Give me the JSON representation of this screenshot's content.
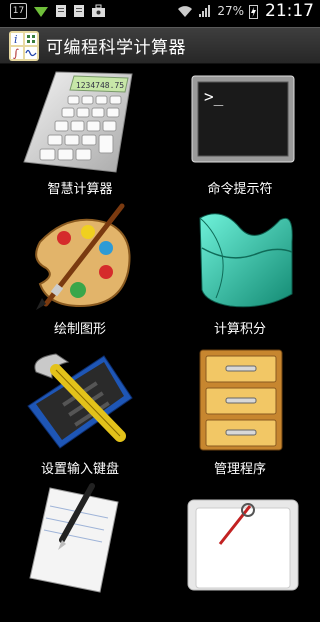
{
  "status_bar": {
    "notification_count": "17",
    "battery_percent": "27%",
    "time": "21:17",
    "icons": [
      "badge-icon",
      "wifi-signal-icon",
      "document-icon",
      "document-icon",
      "briefcase-icon",
      "wifi-icon",
      "cell-signal-icon",
      "charging-icon"
    ]
  },
  "app": {
    "title": "可编程科学计算器"
  },
  "items": [
    {
      "label": "智慧计算器",
      "icon": "calculator-icon"
    },
    {
      "label": "命令提示符",
      "icon": "terminal-icon"
    },
    {
      "label": "绘制图形",
      "icon": "paint-palette-icon"
    },
    {
      "label": "计算积分",
      "icon": "surface-3d-icon"
    },
    {
      "label": "设置输入键盘",
      "icon": "keyboard-hammer-icon"
    },
    {
      "label": "管理程序",
      "icon": "filing-cabinet-icon"
    },
    {
      "label": "",
      "icon": "notepad-pen-icon"
    },
    {
      "label": "",
      "icon": "settings-tool-icon"
    }
  ],
  "calculator_display": "1234748.75",
  "terminal_prompt": ">_",
  "colors": {
    "background": "#000000",
    "titlebar": "#333333",
    "accent": "#2fc8b0"
  }
}
